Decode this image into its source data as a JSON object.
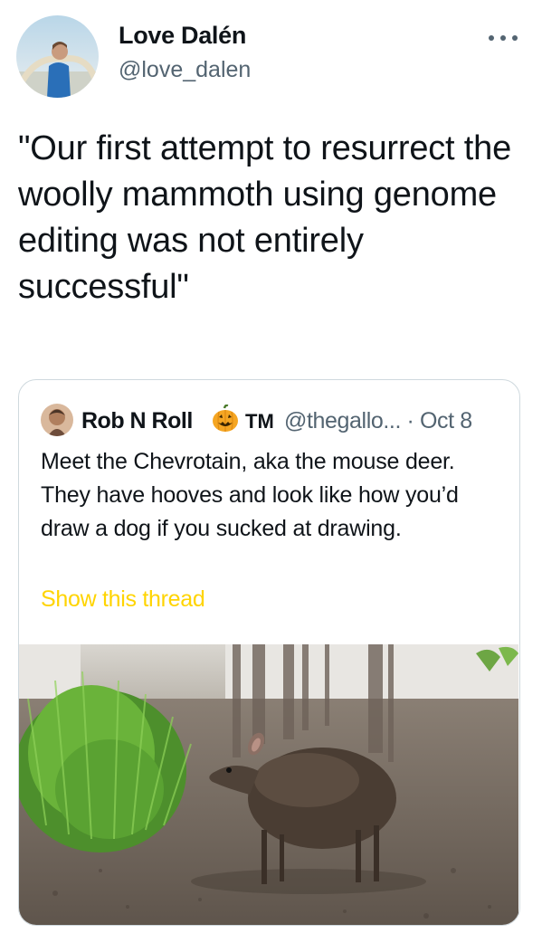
{
  "author": {
    "name": "Love Dalén",
    "handle": "@love_dalen",
    "avatar_icon": "profile-photo-man-with-tusks"
  },
  "more_icon": "more-options-icon",
  "tweet": {
    "text": "\"Our first attempt to resurrect the woolly mammoth using genome editing was not entirely successful\""
  },
  "quoted": {
    "name": "Rob N Roll",
    "emoji_icon": "jack-o-lantern-icon",
    "tm": "TM",
    "handle_date": "@thegallo... · Oct 8",
    "text": "Meet the Chevrotain, aka the mouse deer. They have hooves and look like how you’d draw a dog if you sucked at drawing.",
    "show_thread": "Show this thread",
    "image_icon": "chevrotain-photo"
  },
  "colors": {
    "text": "#0f1419",
    "secondary": "#536471",
    "show_thread": "#ffd400",
    "border": "#cfd9de"
  }
}
